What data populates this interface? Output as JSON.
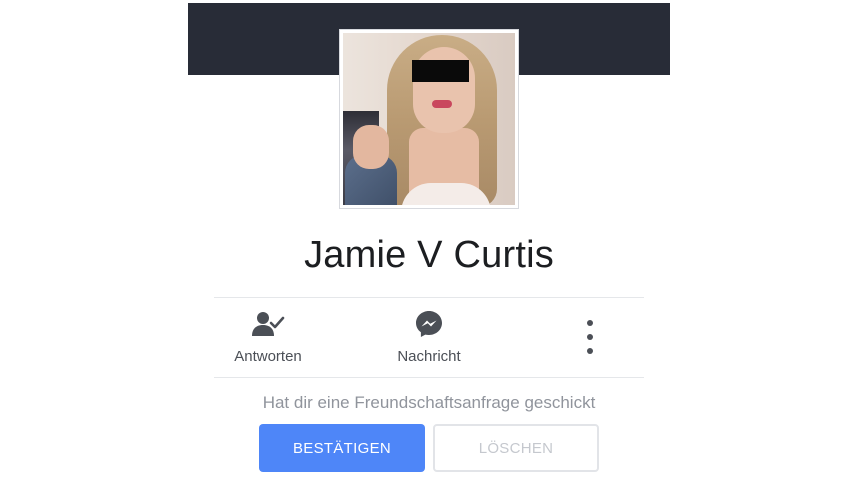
{
  "profile": {
    "name": "Jamie V Curtis"
  },
  "actions": {
    "reply_label": "Antworten",
    "message_label": "Nachricht"
  },
  "request": {
    "text": "Hat dir eine Freundschaftsanfrage geschickt",
    "confirm_label": "BESTÄTIGEN",
    "delete_label": "LÖSCHEN"
  },
  "colors": {
    "cover": "#282c37",
    "accent": "#4e86f8",
    "icon": "#4b4f56"
  },
  "icons": [
    "person-check-icon",
    "messenger-icon",
    "more-vertical-icon"
  ]
}
